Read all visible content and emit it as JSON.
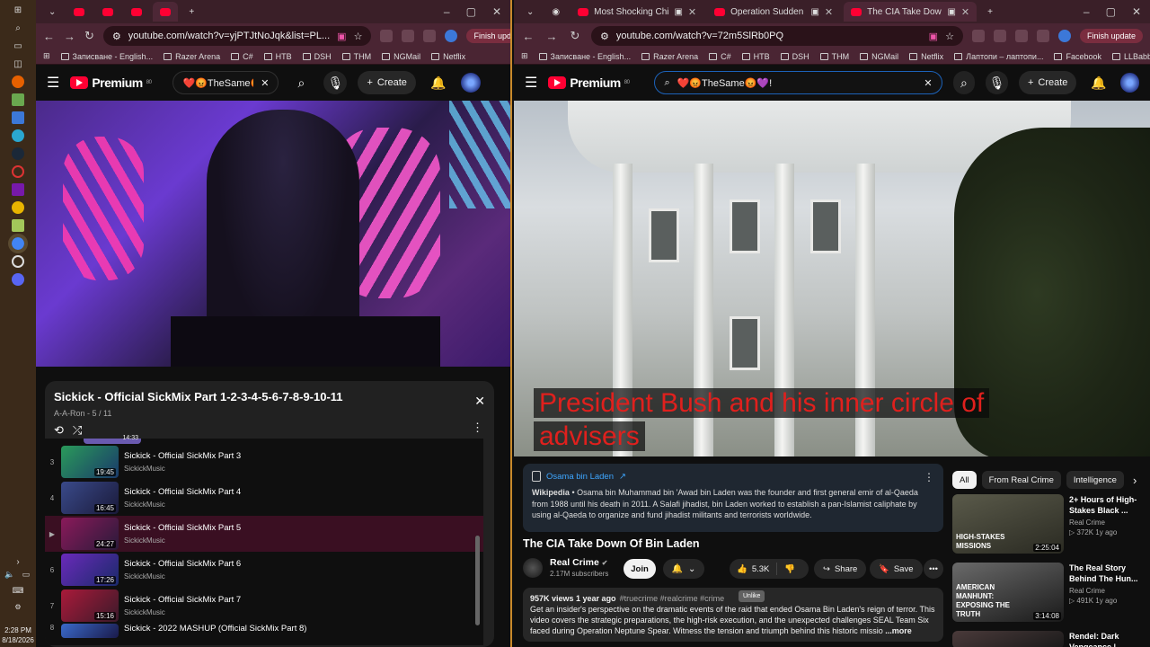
{
  "taskbar": {
    "time": "2:28 PM",
    "date": "8/18/2026"
  },
  "left": {
    "tabs": [
      {
        "label": ""
      },
      {
        "label": ""
      },
      {
        "label": ""
      },
      {
        "label": ""
      }
    ],
    "url": "youtube.com/watch?v=yjPTJtNoJqk&list=PL...",
    "finish_update": "Finish update",
    "bookmarks": [
      "Записване - English...",
      "Razer Arena",
      "C#",
      "HTB",
      "DSH",
      "THM",
      "NGMail",
      "Netflix"
    ],
    "search_value": "❤️😡TheSame😡💜!",
    "create_label": "Create",
    "logo": "Premium",
    "logo_sup": "80",
    "playlist": {
      "title": "Sickick - Official SickMix Part 1-2-3-4-5-6-7-8-9-10-11",
      "sub": "A-A-Ron - 5 / 11",
      "top_dur": "14:33",
      "items": [
        {
          "idx": "3",
          "title": "Sickick - Official SickMix Part 3",
          "channel": "SickickMusic",
          "dur": "19:45"
        },
        {
          "idx": "4",
          "title": "Sickick - Official SickMix Part 4",
          "channel": "SickickMusic",
          "dur": "16:45"
        },
        {
          "idx": "▶",
          "title": "Sickick - Official SickMix Part 5",
          "channel": "SickickMusic",
          "dur": "24:27"
        },
        {
          "idx": "6",
          "title": "Sickick - Official SickMix Part 6",
          "channel": "SickickMusic",
          "dur": "17:26"
        },
        {
          "idx": "7",
          "title": "Sickick - Official SickMix Part 7",
          "channel": "SickickMusic",
          "dur": "15:16"
        },
        {
          "idx": "8",
          "title": "Sickick - 2022 MASHUP (Official SickMix Part 8)",
          "channel": "",
          "dur": ""
        }
      ]
    }
  },
  "right": {
    "tabs": [
      {
        "label": "Most Shocking Child Murd"
      },
      {
        "label": "Operation Sudden Death: T"
      },
      {
        "label": "The CIA Take Down Of Bin"
      }
    ],
    "url": "youtube.com/watch?v=72m5SlRb0PQ",
    "finish_update": "Finish update",
    "bookmarks": [
      "Записване - English...",
      "Razer Arena",
      "C#",
      "HTB",
      "DSH",
      "THM",
      "NGMail",
      "Netflix",
      "Лаптопи – лаптопи...",
      "Facebook",
      "LLBabbel"
    ],
    "search_value": "❤️😡TheSame😡💜!",
    "create_label": "Create",
    "logo": "Premium",
    "logo_sup": "80",
    "caption_line1": "President Bush and his inner circle of",
    "caption_line2": "advisers",
    "wiki": {
      "link": "Osama bin Laden",
      "source": "Wikipedia",
      "text": " • Osama bin Muhammad bin 'Awad bin Laden was the founder and first general emir of al-Qaeda from 1988 until his death in 2011. A Salafi jihadist, bin Laden worked to establish a pan-Islamist caliphate by using al-Qaeda to organize and fund jihadist militants and terrorists worldwide."
    },
    "video_title": "The CIA Take Down Of Bin Laden",
    "channel": {
      "name": "Real Crime",
      "subs": "2.17M subscribers"
    },
    "join_label": "Join",
    "likes": "5.3K",
    "share_label": "Share",
    "save_label": "Save",
    "tooltip": "Unlike",
    "desc": {
      "stats": "957K views  1 year ago",
      "tags": "#truecrime #realcrime #crime",
      "text": "Get an insider's perspective on the dramatic events of the raid that ended Osama Bin Laden's reign of terror. This video covers the strategic preparations, the high-risk execution, and the unexpected challenges SEAL Team Six faced during Operation Neptune Spear. Witness the tension and triumph behind this historic missio",
      "more": "...more"
    },
    "chips": [
      "All",
      "From Real Crime",
      "Intelligence"
    ],
    "recs": [
      {
        "title": "2+ Hours of High-Stakes Black ...",
        "channel": "Real Crime",
        "meta": "▷ 372K  1y ago",
        "dur": "2:25:04",
        "cap": "HIGH-STAKES MISSIONS"
      },
      {
        "title": "The Real Story Behind The Hun...",
        "channel": "Real Crime",
        "meta": "▷ 491K  1y ago",
        "dur": "3:14:08",
        "cap": "AMERICAN MANHUNT: EXPOSING THE TRUTH"
      },
      {
        "title": "Rendel: Dark Vengeance |",
        "channel": "",
        "meta": "",
        "dur": "",
        "cap": ""
      }
    ]
  }
}
